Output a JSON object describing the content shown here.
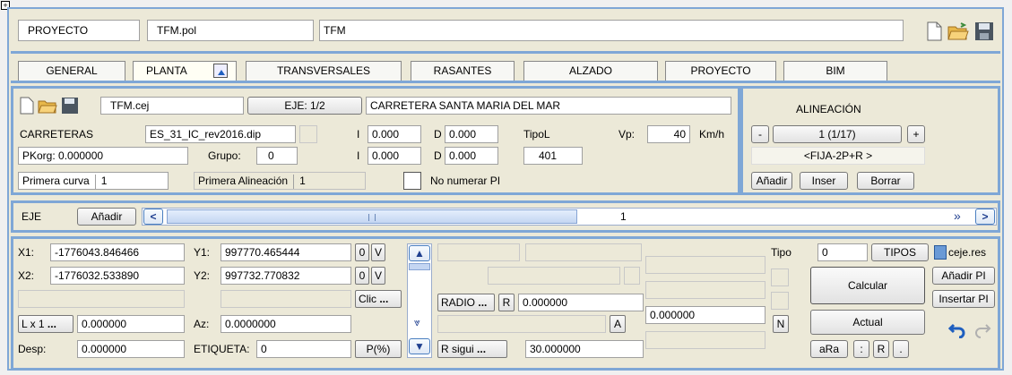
{
  "header": {
    "section_label": "PROYECTO",
    "file_name": "TFM.pol",
    "project_name": "TFM"
  },
  "tabs": [
    {
      "label": "GENERAL"
    },
    {
      "label": "PLANTA"
    },
    {
      "label": "TRANSVERSALES"
    },
    {
      "label": "RASANTES"
    },
    {
      "label": "ALZADO"
    },
    {
      "label": "PROYECTO"
    },
    {
      "label": "BIM"
    }
  ],
  "axis": {
    "file": "TFM.cej",
    "eje_button": "EJE: 1/2",
    "road_name": "CARRETERA SANTA MARIA DEL MAR",
    "carreteras_label": "CARRETERAS",
    "carreteras_file": "ES_31_IC_rev2016.dip",
    "i_label": "I",
    "d_label": "D",
    "i1": "0.000",
    "d1": "0.000",
    "i2": "0.000",
    "d2": "0.000",
    "tipol_label": "TipoL",
    "tipol_value": "401",
    "vp_label": "Vp:",
    "vp_value": "40",
    "vp_unit": "Km/h",
    "pkorg_label": "PKorg:",
    "pkorg_value": "0.000000",
    "grupo_label": "Grupo:",
    "grupo_value": "0",
    "primera_curva_label": "Primera curva",
    "primera_curva_value": "1",
    "primera_alineacion_label": "Primera Alineación",
    "primera_alineacion_value": "1",
    "no_numerar_label": "No numerar PI"
  },
  "alignment": {
    "title": "ALINEACIÓN",
    "minus": "-",
    "plus": "+",
    "counter": "1 (1/17)",
    "type": "<FIJA-2P+R >",
    "add": "Añadir",
    "insert": "Inser",
    "delete": "Borrar"
  },
  "eje_bar": {
    "label": "EJE",
    "add": "Añadir",
    "left_arrow": "<",
    "value": "1",
    "right_arrow": ">",
    "fast_forward": "»"
  },
  "coords": {
    "x1_label": "X1:",
    "x1": "-1776043.846466",
    "y1_label": "Y1:",
    "y1": "997770.465444",
    "x2_label": "X2:",
    "x2": "-1776032.533890",
    "y2_label": "Y2:",
    "y2": "997732.770832",
    "zero": "0",
    "v": "V",
    "clic": "Clic",
    "dots": "...",
    "lx1": "L x 1",
    "lx1_value": "0.000000",
    "az_label": "Az:",
    "az_value": "0.0000000",
    "desp_label": "Desp:",
    "desp_value": "0.000000",
    "etiqueta_label": "ETIQUETA:",
    "etiqueta_value": "0",
    "pct": "P(%)",
    "radio": "RADIO",
    "r": "R",
    "radio_value": "0.000000",
    "a": "A",
    "mid_value": "0.000000",
    "n": "N",
    "rsigui": "R sigui",
    "rsigui_value": "30.000000"
  },
  "right": {
    "tipo_label": "Tipo",
    "tipo_value": "0",
    "tipos": "TIPOS",
    "res_file": "ceje.res",
    "calcular": "Calcular",
    "anadir_pi": "Añadir PI",
    "insertar_pi": "Insertar PI",
    "actual": "Actual",
    "ara": "aRa",
    "colon": ":",
    "r": "R",
    "dot": "."
  }
}
